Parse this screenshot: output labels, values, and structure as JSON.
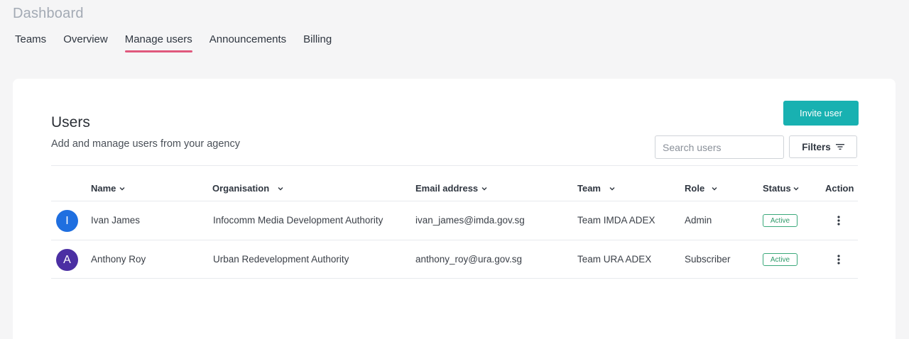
{
  "header": {
    "title": "Dashboard"
  },
  "tabs": [
    {
      "label": "Teams",
      "active": false
    },
    {
      "label": "Overview",
      "active": false
    },
    {
      "label": "Manage users",
      "active": true
    },
    {
      "label": "Announcements",
      "active": false
    },
    {
      "label": "Billing",
      "active": false
    }
  ],
  "users_panel": {
    "title": "Users",
    "subtitle": "Add and manage users from your agency",
    "invite_label": "Invite user",
    "search_placeholder": "Search users",
    "filters_label": "Filters"
  },
  "table": {
    "columns": [
      "Name",
      "Organisation",
      "Email address",
      "Team",
      "Role",
      "Status",
      "Action"
    ],
    "rows": [
      {
        "initial": "I",
        "avatar_color": "#1f6fe0",
        "name": "Ivan James",
        "organisation": "Infocomm Media Development Authority",
        "email": "ivan_james@imda.gov.sg",
        "team": "Team IMDA ADEX",
        "role": "Admin",
        "status": "Active"
      },
      {
        "initial": "A",
        "avatar_color": "#4b2fa3",
        "name": "Anthony Roy",
        "organisation": "Urban Redevelopment Authority",
        "email": "anthony_roy@ura.gov.sg",
        "team": "Team URA ADEX",
        "role": "Subscriber",
        "status": "Active"
      }
    ]
  },
  "colors": {
    "accent": "#18b1b1",
    "tab_indicator": "#e0587d",
    "active_badge": "#3aa87a"
  }
}
